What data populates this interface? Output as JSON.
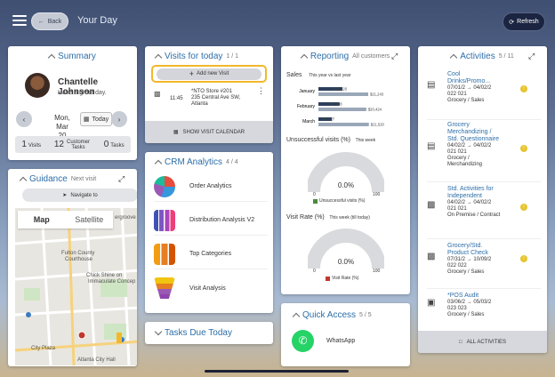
{
  "header": {
    "back_label": "Back",
    "title": "Your Day",
    "refresh_label": "Refresh"
  },
  "summary": {
    "title": "Summary",
    "name": "Chantelle Johnson",
    "greeting": "Have a great day.",
    "date_line1": "Mon, Mar",
    "date_line2": "20",
    "today_label": "Today",
    "stats": [
      {
        "value": "1",
        "label": "Visits"
      },
      {
        "value": "12",
        "label": "Customer Tasks"
      },
      {
        "value": "0",
        "label": "Tasks"
      }
    ]
  },
  "guidance": {
    "title": "Guidance",
    "subtitle": "Next visit",
    "navigate_label": "Navigate to",
    "map_tab_map": "Map",
    "map_tab_satellite": "Satellite",
    "map_labels": [
      "ergroove",
      "Fulton County",
      "Courthouse",
      "Chick Shine on",
      "Immaculate Concep",
      "City Plaza",
      "Atlanta City Hall"
    ]
  },
  "visits": {
    "title": "Visits for today",
    "count": "1 / 1",
    "add_label": "Add new Visit",
    "row": {
      "time": "11:45",
      "name": "*NTO Store #201",
      "address1": "235 Central Ave SW,",
      "address2": "Atlanta"
    },
    "calendar_label": "SHOW VISIT CALENDAR"
  },
  "crm": {
    "title": "CRM Analytics",
    "count": "4 / 4",
    "items": [
      "Order Analytics",
      "Distribution Analysis V2",
      "Top Categories",
      "Visit Analysis"
    ]
  },
  "tasks_due": {
    "title": "Tasks Due Today"
  },
  "reporting": {
    "title": "Reporting",
    "subtitle": "All customers",
    "sales_label": "Sales",
    "sales_sub": "This year vs last year",
    "unsuccessful_label": "Unsuccessful visits (%)",
    "unsuccessful_sub": "This week",
    "unsuccessful_value": "0.0%",
    "unsuccessful_legend": "Unsuccessful visits (%)",
    "visit_rate_label": "Visit Rate (%)",
    "visit_rate_sub": "This week (till today)",
    "visit_rate_value": "0.0%",
    "visit_rate_legend": "Visit Rate (%)",
    "gauge_min": "0",
    "gauge_max": "100",
    "unsuccessful_color": "#4b8b3b",
    "visit_rate_color": "#c0392b"
  },
  "chart_data": {
    "type": "bar",
    "categories": [
      "January",
      "February",
      "March"
    ],
    "series": [
      {
        "values": [
          10220,
          8998,
          5777
        ],
        "labels": [
          "$10,220",
          "$8,998",
          "$5,777"
        ],
        "color": "#2d3f5c"
      },
      {
        "values": [
          21243,
          20424,
          21520
        ],
        "labels": [
          "$21,243",
          "$20,424",
          "$21,520"
        ],
        "color": "#9aa7b8"
      }
    ]
  },
  "quick_access": {
    "title": "Quick Access",
    "count": "5 / 5",
    "items": [
      "WhatsApp"
    ]
  },
  "activities": {
    "title": "Activities",
    "count": "5 / 11",
    "items": [
      {
        "title1": "Cool",
        "title2": "Drinks/Promo...",
        "dates1": "07/01/2 → 04/02/2",
        "dates2": "022 021",
        "type": "Grocery / Sales",
        "badge": "!"
      },
      {
        "title1": "Grocery",
        "title2": "Merchandizing /",
        "title3": "Std. Questionnaire",
        "dates1": "04/02/2 → 04/02/2",
        "dates2": "021 021",
        "type": "Grocery / Merchandizing",
        "badge": "!"
      },
      {
        "title1": "Std. Activities for",
        "title2": "Independent",
        "dates1": "04/02/2 → 04/02/2",
        "dates2": "021 021",
        "type": "On Premise / Contract",
        "badge": "!"
      },
      {
        "title1": "Grocery/Std.",
        "title2": "Product Check",
        "dates1": "07/31/2 → 10/09/2",
        "dates2": "022 022",
        "type": "Grocery / Sales",
        "badge": "!"
      },
      {
        "title1": "*POS Audit",
        "title2": "",
        "dates1": "03/06/2 → 05/03/2",
        "dates2": "023 023",
        "type": "Grocery / Sales"
      }
    ],
    "all_label": "ALL ACTIVITIES"
  }
}
